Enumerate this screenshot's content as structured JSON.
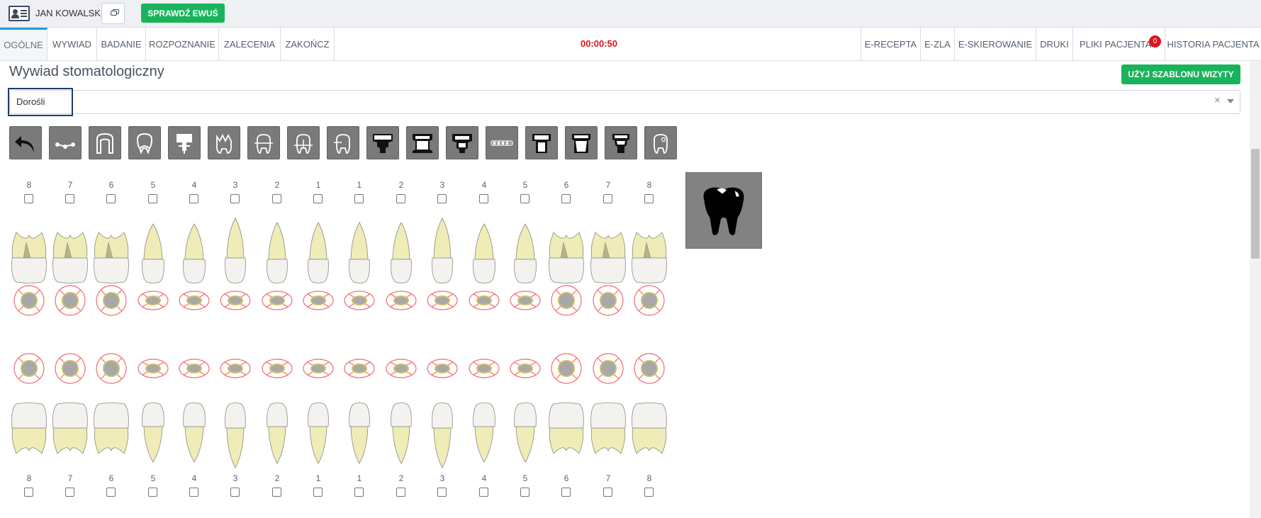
{
  "header": {
    "patient_name": "JAN KOWALSKI",
    "ewus_button": "SPRAWDŹ EWUŚ"
  },
  "tabs": {
    "left": [
      "OGÓLNE",
      "WYWIAD",
      "BADANIE",
      "ROZPOZNANIE",
      "ZALECENIA",
      "ZAKOŃCZ"
    ],
    "timer": "00:00:50",
    "right": [
      "E-RECEPTA",
      "E-ZLA",
      "E-SKIEROWANIE",
      "DRUKI",
      "PLIKI PACJENTA",
      "HISTORIA PACJENTA"
    ],
    "files_badge": "0",
    "active_tab": "OGÓLNE"
  },
  "main": {
    "title": "Wywiad stomatologiczny",
    "template_button": "UŻYJ SZABLONU WIZYTY",
    "select": {
      "value": "Dorośli",
      "clear": "×"
    }
  },
  "toolbar": {
    "tools": [
      "undo-icon",
      "bridge-icon",
      "crown-outline-icon",
      "crown-root-icon",
      "implant-icon",
      "crown-damaged-icon",
      "tooth-filling-icon",
      "tooth-root-filling-icon",
      "tooth-missing-icon",
      "crown-black-icon",
      "pontic-black-icon",
      "inlay-black-icon",
      "braces-icon",
      "post-black-icon",
      "veneer-black-icon",
      "abutment-black-icon",
      "tooth-caries-icon"
    ]
  },
  "chart": {
    "upper_numbers": [
      "8",
      "7",
      "6",
      "5",
      "4",
      "3",
      "2",
      "1",
      "1",
      "2",
      "3",
      "4",
      "5",
      "6",
      "7",
      "8"
    ],
    "lower_numbers": [
      "8",
      "7",
      "6",
      "5",
      "4",
      "3",
      "2",
      "1",
      "1",
      "2",
      "3",
      "4",
      "5",
      "6",
      "7",
      "8"
    ]
  },
  "colors": {
    "green": "#19b35c",
    "accent_blue": "#1a9fd6",
    "timer_red": "#e0101a",
    "tooth_crown": "#f3f2ef",
    "tooth_root": "#efecb8",
    "pulp": "#b3b586",
    "marker_stroke": "#f26b6b",
    "marker_fill": "#a8a8a8",
    "marker_ring": "#cfc06a"
  }
}
